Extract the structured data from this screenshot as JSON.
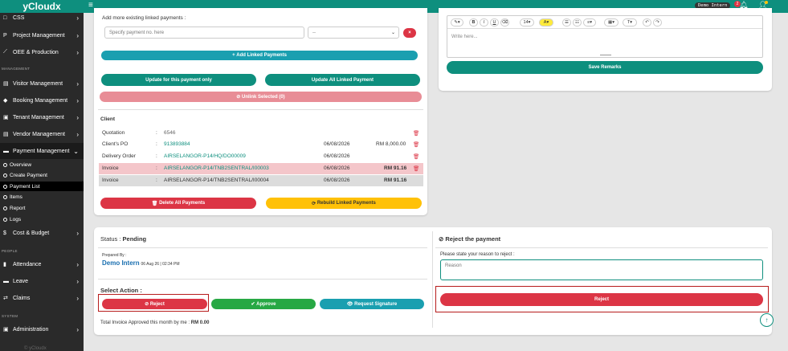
{
  "app": {
    "brand": "yCloudx",
    "user": "Demo Intern",
    "notifications": "2"
  },
  "sidebar": {
    "items": [
      {
        "label": "CSS",
        "icon": "□"
      },
      {
        "label": "Project Management",
        "icon": "P"
      },
      {
        "label": "OEE & Production",
        "icon": "⟋"
      }
    ],
    "section_management": "MANAGEMENT",
    "mgmt": [
      {
        "label": "Visitor Management",
        "icon": "▤"
      },
      {
        "label": "Booking Management",
        "icon": "◆"
      },
      {
        "label": "Tenant Management",
        "icon": "▣"
      },
      {
        "label": "Vendor Management",
        "icon": "▤"
      },
      {
        "label": "Payment Management",
        "icon": "▬"
      }
    ],
    "sub": [
      "Overview",
      "Create Payment",
      "Payment List",
      "Items",
      "Report",
      "Logs"
    ],
    "cost": {
      "label": "Cost & Budget",
      "icon": "$"
    },
    "section_people": "PEOPLE",
    "people": [
      {
        "label": "Attendance",
        "icon": "▮"
      },
      {
        "label": "Leave",
        "icon": "▬"
      },
      {
        "label": "Claims",
        "icon": "⇄"
      }
    ],
    "section_system": "SYSTEM",
    "system": [
      {
        "label": "Administration",
        "icon": "▣"
      }
    ],
    "footer": "© yCloudx"
  },
  "linked": {
    "title": "Add more existing linked payments :",
    "placeholder": "Specify payment no. here",
    "select": "--",
    "add": "Add Linked Payments",
    "update_only": "Update for this payment only",
    "update_all": "Update All Linked Payment",
    "unlink": "Unlink Selected (0)"
  },
  "client": {
    "heading": "Client",
    "rows": [
      {
        "label": "Quotation",
        "value": "6546",
        "date": "",
        "amount": ""
      },
      {
        "label": "Client's PO",
        "value": "913893884",
        "date": "06/08/2026",
        "amount": "RM 8,000.00"
      },
      {
        "label": "Delivery Order",
        "value": "AIRSELANGOR-P14/HQ/DO00009",
        "date": "06/08/2026",
        "amount": ""
      },
      {
        "label": "Invoice",
        "value": "AIRSELANGOR-P14/TNB2SENTRAL/I00003",
        "date": "06/08/2026",
        "amount": "RM 91.16"
      },
      {
        "label": "Invoice",
        "value": "AIRSELANGOR-P14/TNB2SENTRAL/I00004",
        "date": "06/08/2026",
        "amount": "RM 91.16"
      }
    ],
    "delete_all": "Delete All Payments",
    "rebuild": "Rebuild Linked Payments"
  },
  "remarks": {
    "placeholder": "Write here...",
    "font_size": "14",
    "save": "Save Remarks"
  },
  "status": {
    "label": "Status :",
    "value": "Pending",
    "prepared_by": "Prepared By :",
    "name": "Demo Intern",
    "date": "06 Aug 26 | 02:34 PM",
    "select_action": "Select Action :",
    "reject": "Reject",
    "approve": "Approve",
    "request": "Request Signature",
    "total_label": "Total Invoice Approved this month by me :",
    "total_value": "RM 0.00"
  },
  "reject_panel": {
    "title": "Reject the payment",
    "prompt": "Please state your reason to reject :",
    "placeholder": "Reason",
    "button": "Reject"
  }
}
